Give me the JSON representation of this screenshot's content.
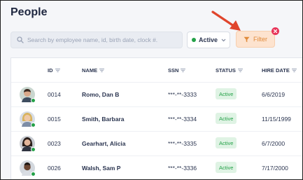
{
  "page": {
    "title": "People"
  },
  "toolbar": {
    "search_placeholder": "Search by employee name, id, birth date, clock #.",
    "status_filter_value": "Active",
    "filter_label": "Filter"
  },
  "table": {
    "columns": [
      "ID",
      "NAME",
      "SSN",
      "STATUS",
      "HIRE DATE"
    ],
    "rows": [
      {
        "id": "0014",
        "name": "Romo, Dan B",
        "ssn": "***-**-3333",
        "status": "Active",
        "hire_date": "6/6/2019"
      },
      {
        "id": "0015",
        "name": "Smith, Barbara",
        "ssn": "***-**-3334",
        "status": "Active",
        "hire_date": "11/15/1999"
      },
      {
        "id": "0023",
        "name": "Gearhart, Alicia",
        "ssn": "***-**-3335",
        "status": "Active",
        "hire_date": "6/7/2000"
      },
      {
        "id": "0026",
        "name": "Walsh, Sam P",
        "ssn": "***-**-3336",
        "status": "Active",
        "hire_date": "7/17/2000"
      }
    ]
  },
  "colors": {
    "accent_orange": "#e08a3a",
    "active_green": "#24a148",
    "clear_red": "#e8355a",
    "annotation_arrow": "#e0452c"
  },
  "icons": {
    "search": "search-icon",
    "status_dot": "green-dot-icon",
    "dropdown": "chevron-down-icon",
    "filter": "funnel-icon",
    "clear_filter": "close-icon",
    "sort": "sort-icon",
    "presence": "online-dot-icon"
  }
}
